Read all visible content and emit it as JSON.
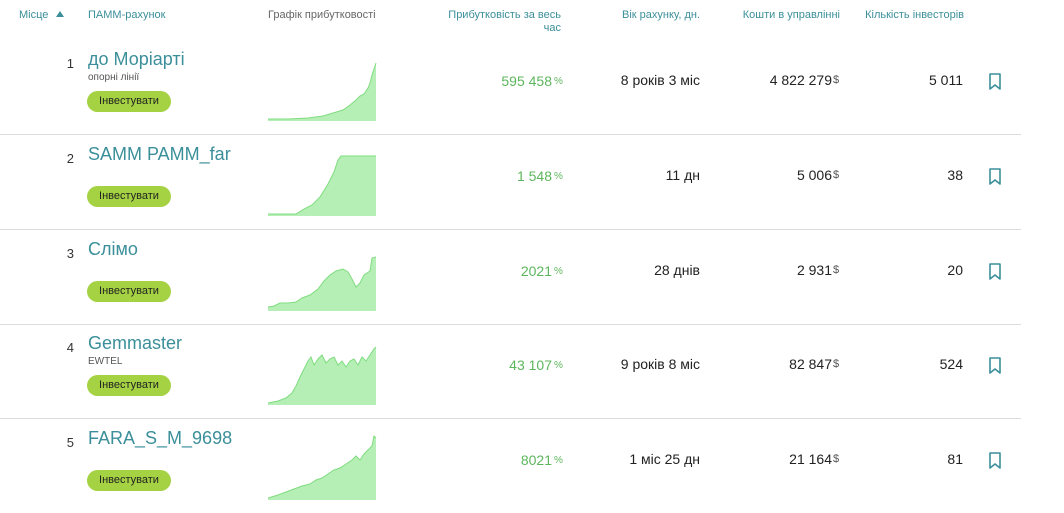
{
  "header": {
    "rank": "Місце",
    "account": "ПАММ-рахунок",
    "chart": "Графік прибутковості",
    "profit_line1": "Прибутковість за весь",
    "profit_line2": "час",
    "age": "Вік рахунку, дн.",
    "funds": "Кошти в управлінні",
    "investors": "Кількість інвесторів"
  },
  "colors": {
    "accent": "#3b8f9a",
    "profit": "#5db65d",
    "invest_button": "#a5d243",
    "chart_fill": "#b5efb5",
    "chart_line": "#7fdc7f"
  },
  "icons": {
    "sort": "sort-ascending-icon",
    "bookmark": "bookmark-icon"
  },
  "rows": [
    {
      "rank": "1",
      "name": "до Моріарті",
      "sub": "опорні лінії",
      "invest": "Інвестувати",
      "profit": "595 458",
      "pct": "%",
      "age": "8 років 3 міс",
      "funds": "4 822 279",
      "currency": "$",
      "investors": "5 011"
    },
    {
      "rank": "2",
      "name": "SAMM PAMM_far",
      "sub": "",
      "invest": "Інвестувати",
      "profit": "1 548",
      "pct": "%",
      "age": "11 дн",
      "funds": "5 006",
      "currency": "$",
      "investors": "38"
    },
    {
      "rank": "3",
      "name": "Слімо",
      "sub": "",
      "invest": "Інвестувати",
      "profit": "2021",
      "pct": "%",
      "age": "28 днів",
      "funds": "2 931",
      "currency": "$",
      "investors": "20"
    },
    {
      "rank": "4",
      "name": "Gemmaster",
      "sub": "EWTEL",
      "invest": "Інвестувати",
      "profit": "43 107",
      "pct": "%",
      "age": "9 років 8 міс",
      "funds": "82 847",
      "currency": "$",
      "investors": "524"
    },
    {
      "rank": "5",
      "name": "FARA_S_M_9698",
      "sub": "",
      "invest": "Інвестувати",
      "profit": "8021",
      "pct": "%",
      "age": "1 міс 25 дн",
      "funds": "21 164",
      "currency": "$",
      "investors": "81"
    }
  ]
}
